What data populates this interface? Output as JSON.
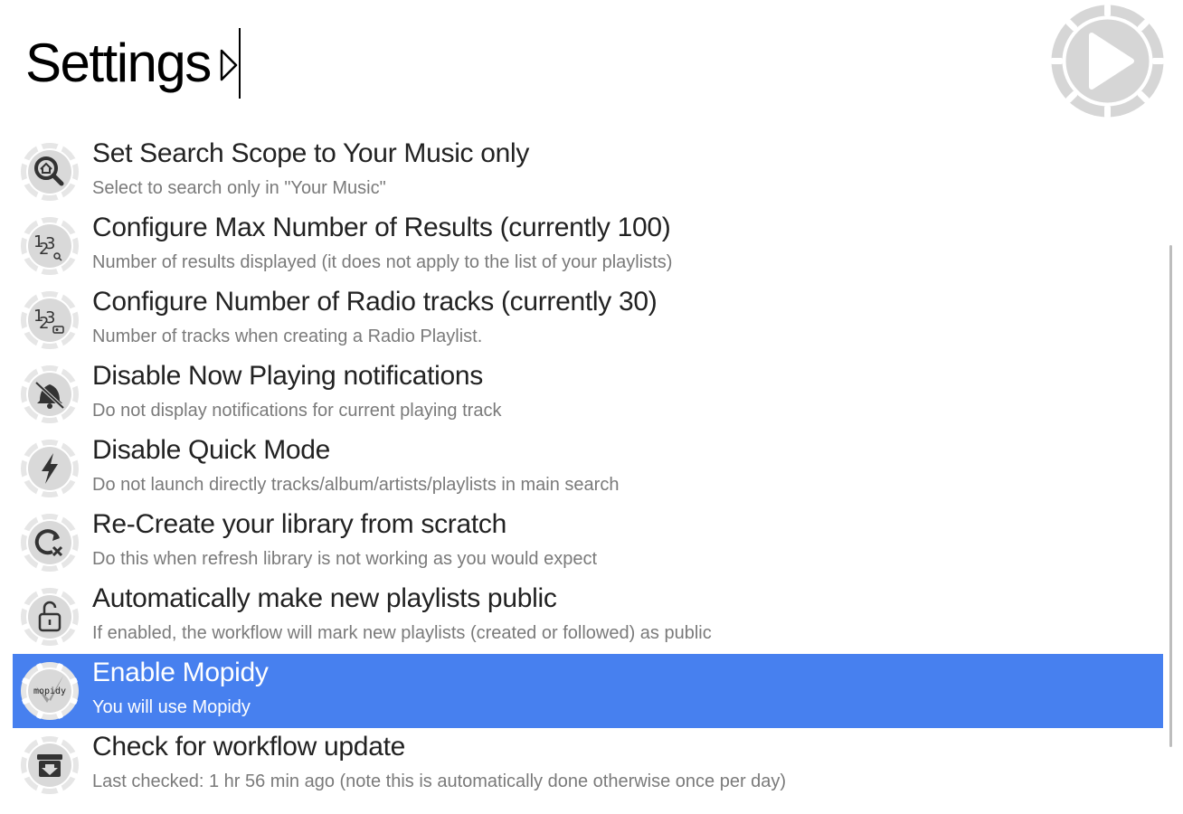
{
  "query": {
    "text": "Settings"
  },
  "results": [
    {
      "title": "Set Search Scope to Your Music only",
      "subtitle": "Select to search only in \"Your Music\"",
      "icon": "search-home-icon"
    },
    {
      "title": "Configure Max Number of Results (currently 100)",
      "subtitle": "Number of results displayed (it does not apply to the list of your playlists)",
      "icon": "numbers-search-icon"
    },
    {
      "title": "Configure Number of Radio tracks (currently 30)",
      "subtitle": "Number of tracks when creating a Radio Playlist.",
      "icon": "numbers-radio-icon"
    },
    {
      "title": "Disable Now Playing notifications",
      "subtitle": "Do not display notifications for current playing track",
      "icon": "bell-off-icon"
    },
    {
      "title": "Disable Quick Mode",
      "subtitle": "Do not launch directly tracks/album/artists/playlists in main search",
      "icon": "lightning-icon"
    },
    {
      "title": "Re-Create your library from scratch",
      "subtitle": "Do this when refresh library is not working as you would expect",
      "icon": "refresh-cancel-icon"
    },
    {
      "title": "Automatically make new playlists public",
      "subtitle": "If enabled, the workflow will mark new playlists (created or followed) as public",
      "icon": "unlock-icon"
    },
    {
      "title": "Enable Mopidy",
      "subtitle": "You will use Mopidy",
      "icon": "mopidy-icon",
      "logo_text": "mopidy",
      "selected": true
    },
    {
      "title": "Check for workflow update",
      "subtitle": "Last checked: 1 hr 56 min ago (note this is automatically done otherwise once per day)",
      "icon": "download-box-icon"
    }
  ],
  "colors": {
    "selection": "#4780ef",
    "icon_disc": "#e3e3e3",
    "icon_glyph": "#333333"
  }
}
